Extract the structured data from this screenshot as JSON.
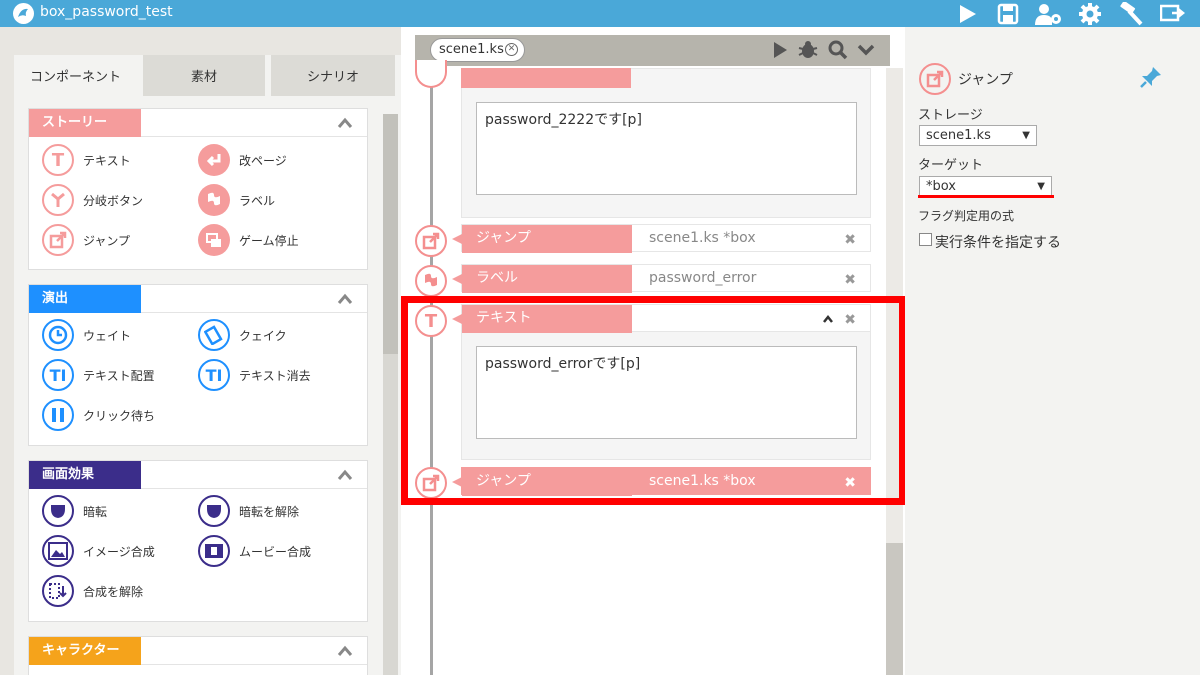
{
  "app": {
    "title": "box_password_test"
  },
  "colors": {
    "accent": "#4aa8d8",
    "story": "#f59c9c",
    "effect": "#1e90ff",
    "screen": "#3b2d8a",
    "chara": "#f5a31b",
    "highlight": "#ff0000"
  },
  "left": {
    "tabs": [
      "コンポーネント",
      "素材",
      "シナリオ"
    ],
    "categories": [
      {
        "label": "ストーリー",
        "items": [
          "テキスト",
          "改ページ",
          "分岐ボタン",
          "ラベル",
          "ジャンプ",
          "ゲーム停止"
        ]
      },
      {
        "label": "演出",
        "items": [
          "ウェイト",
          "クェイク",
          "テキスト配置",
          "テキスト消去",
          "クリック待ち"
        ]
      },
      {
        "label": "画面効果",
        "items": [
          "暗転",
          "暗転を解除",
          "イメージ合成",
          "ムービー合成",
          "合成を解除"
        ]
      },
      {
        "label": "キャラクター",
        "items": []
      }
    ]
  },
  "middle": {
    "scene_tab": "scene1.ks",
    "blocks": [
      {
        "type": "テキスト",
        "text": "password_2222です[p]"
      },
      {
        "type": "ジャンプ",
        "value": "scene1.ks *box"
      },
      {
        "type": "ラベル",
        "value": "password_error"
      },
      {
        "type": "テキスト",
        "text": "password_errorです[p]"
      },
      {
        "type": "ジャンプ",
        "value": "scene1.ks *box"
      }
    ]
  },
  "right": {
    "title": "ジャンプ",
    "storage_label": "ストレージ",
    "storage_value": "scene1.ks",
    "target_label": "ターゲット",
    "target_value": "*box",
    "flag_label": "フラグ判定用の式",
    "condition_label": "実行条件を指定する"
  }
}
